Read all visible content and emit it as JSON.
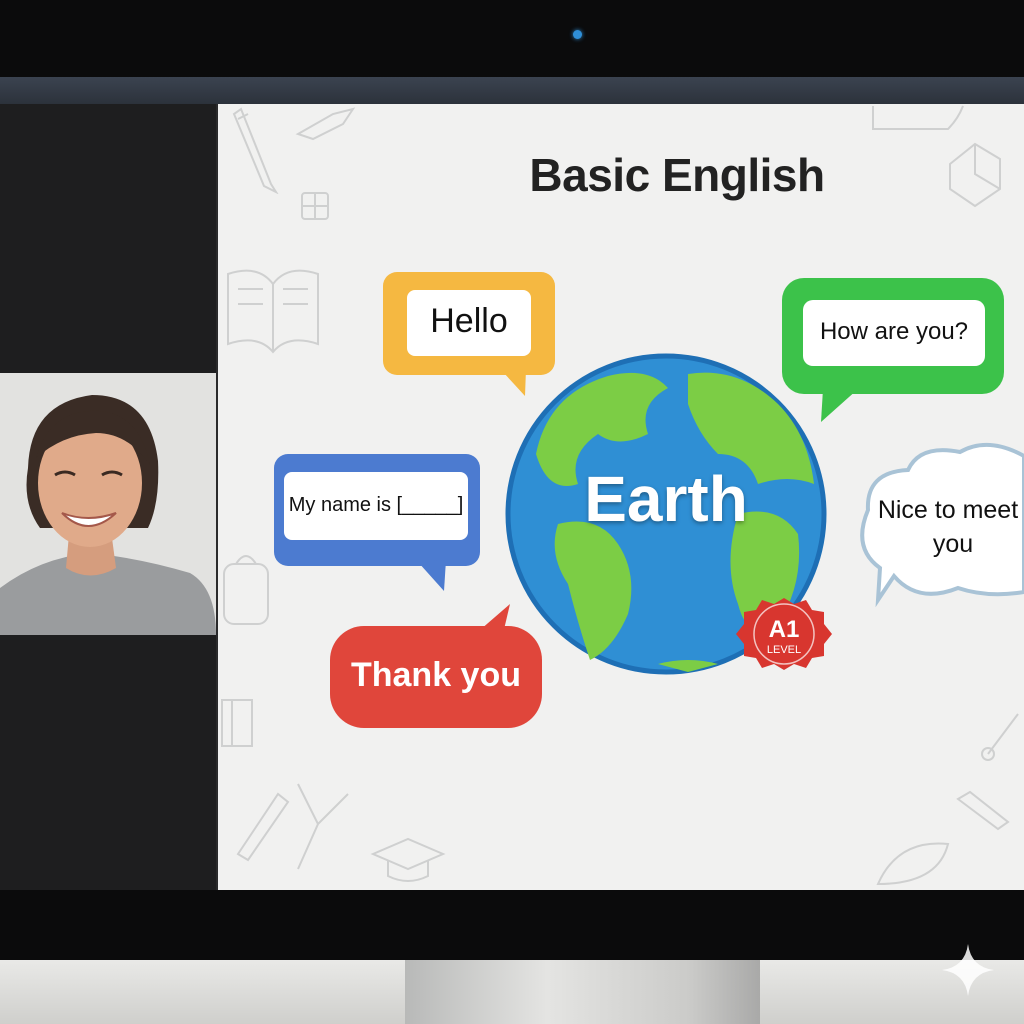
{
  "slide": {
    "title": "Basic English",
    "globe_label": "Earth",
    "badge": {
      "main": "A1",
      "sub": "LEVEL"
    },
    "bubbles": {
      "hello": "Hello",
      "how_are_you": "How are you?",
      "my_name": "My name is [_____]",
      "nice_line1": "Nice to meet",
      "nice_line2": "you",
      "thank_you": "Thank you"
    }
  },
  "colors": {
    "hello": "#f5b841",
    "how_are_you": "#3cc24a",
    "my_name": "#4c7bd0",
    "thank_you": "#e0463b",
    "nice": "#a9c3d6",
    "active_speaker": "#3ccf5a",
    "badge": "#d8362f"
  },
  "icons": [
    "pencil-icon",
    "book-icon",
    "graduation-cap-icon",
    "lightbulb-icon",
    "backpack-icon"
  ]
}
